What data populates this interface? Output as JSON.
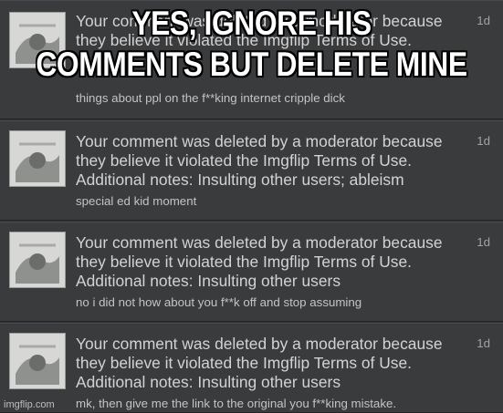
{
  "caption": {
    "line1": "YES, IGNORE HIS",
    "line2": "COMMENTS BUT DELETE MINE"
  },
  "notifications": [
    {
      "message": "Your comment was deleted by a moderator because they believe it violated the Imgflip Terms of Use.",
      "comment": "things about ppl on the f**king internet cripple dick",
      "time": "1d"
    },
    {
      "message": "Your comment was deleted by a moderator because they believe it violated the Imgflip Terms of Use. Additional notes: Insulting other users; ableism",
      "comment": "special ed kid moment",
      "time": "1d"
    },
    {
      "message": "Your comment was deleted by a moderator because they believe it violated the Imgflip Terms of Use. Additional notes: Insulting other users",
      "comment": "no i did not how about you f**k off and stop assuming",
      "time": "1d"
    },
    {
      "message": "Your comment was deleted by a moderator because they believe it violated the Imgflip Terms of Use. Additional notes: Insulting other users",
      "comment": "mk, then give me the link to the original you f**king mistake.",
      "time": "1d"
    }
  ],
  "watermark": "imgflip.com",
  "icons": {
    "thumbnail": "meme-thumbnail-icon"
  }
}
